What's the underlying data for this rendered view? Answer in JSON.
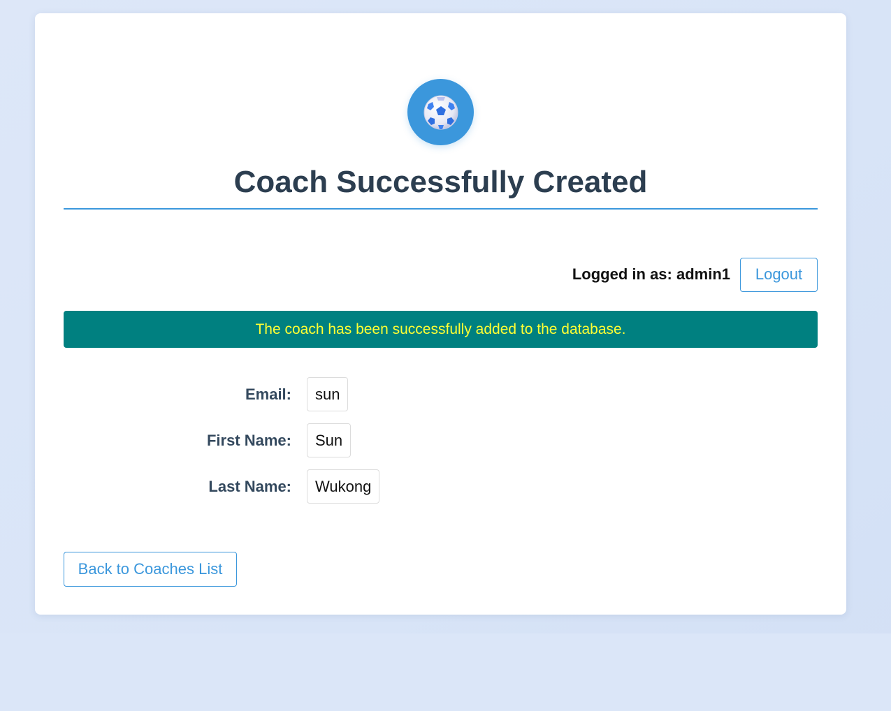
{
  "header": {
    "logo_icon": "soccer-ball-icon",
    "logo_glyph": "⚽",
    "title": "Coach Successfully Created"
  },
  "session": {
    "logged_in_label": "Logged in as: admin1",
    "logout_label": "Logout"
  },
  "alert": {
    "message": "The coach has been successfully added to the database.",
    "background_color": "#008080",
    "text_color": "#ffff33"
  },
  "details": [
    {
      "label": "Email:",
      "value": "sun"
    },
    {
      "label": "First Name:",
      "value": "Sun"
    },
    {
      "label": "Last Name:",
      "value": "Wukong"
    }
  ],
  "actions": {
    "back_label": "Back to Coaches List"
  },
  "theme": {
    "accent": "#3b97dc",
    "heading": "#2c3e50"
  }
}
